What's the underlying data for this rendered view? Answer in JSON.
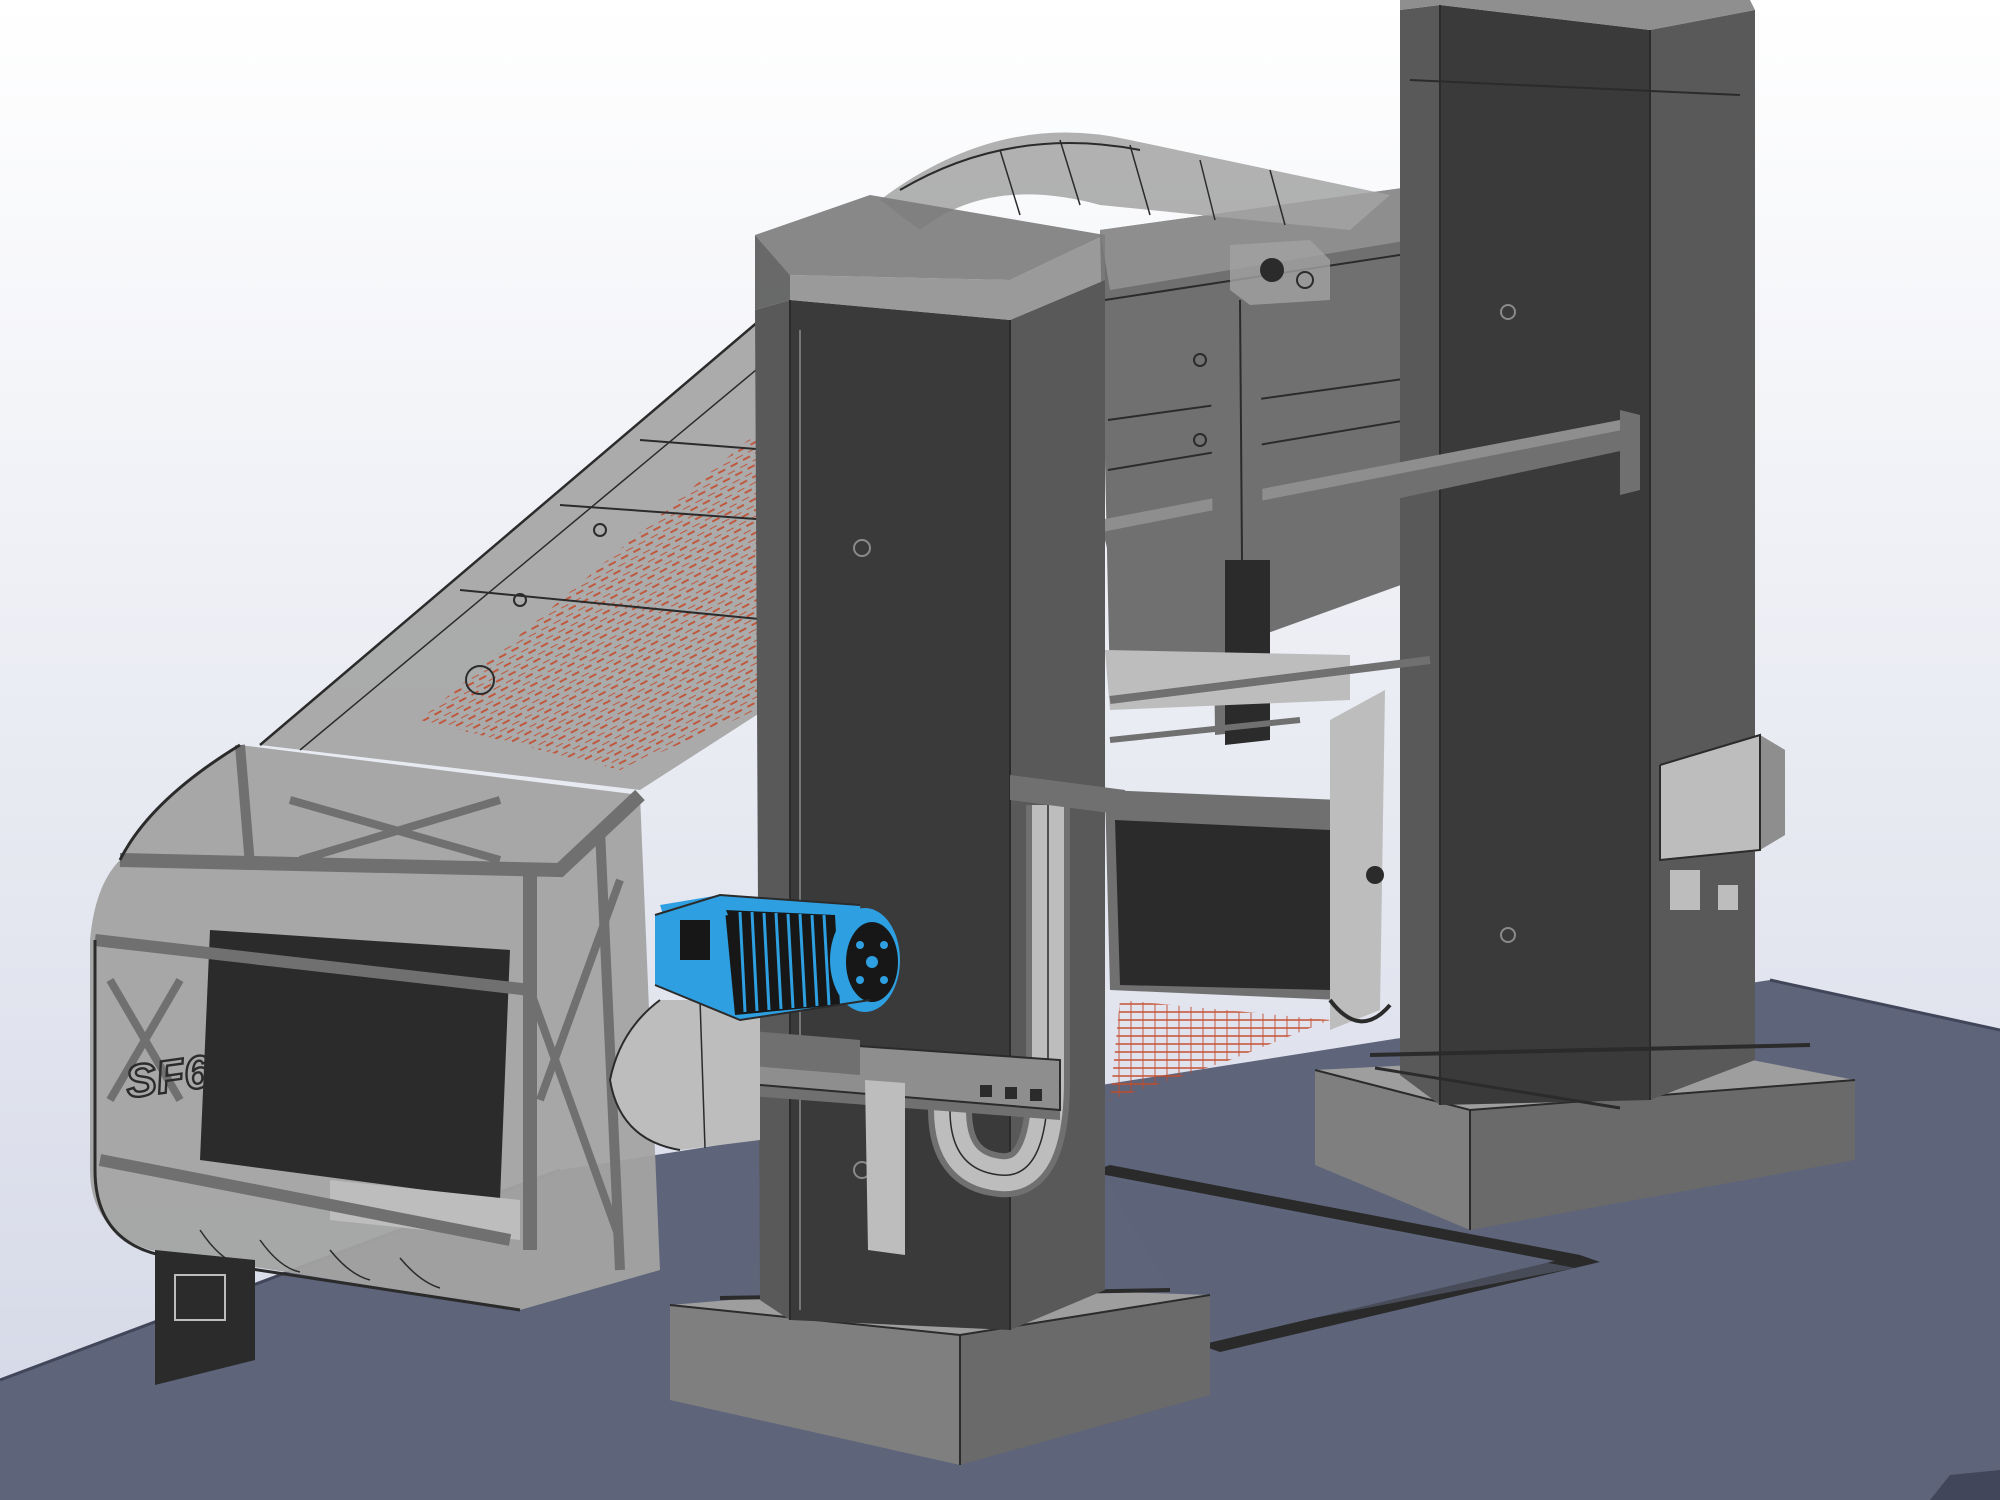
{
  "view": {
    "background_top": "#ffffff",
    "background_bottom": "#d3d7e6"
  },
  "palette": {
    "floor": "#5e6479",
    "floor_edge": "#41465a",
    "base_top": "#9e9e9e",
    "base_front": "#7f7f7f",
    "base_side": "#6a6a6a",
    "column_front": "#3a3a3a",
    "column_side": "#595959",
    "column_cap": "#7b7b7b",
    "frame_dark": "#2b2b2b",
    "frame_mid": "#707070",
    "frame_light": "#8e8e8e",
    "cover_glass": "#a3a3a3",
    "motor_blue": "#2e9fe0",
    "motor_dark": "#171717",
    "mesh_red": "#c44a2a",
    "rail": "#2a2a2a",
    "panel_light": "#bdbdbd"
  },
  "model": {
    "engraving": "SF65"
  },
  "icons": {
    "motor": "electric-motor-icon",
    "control_box": "control-box-icon"
  }
}
